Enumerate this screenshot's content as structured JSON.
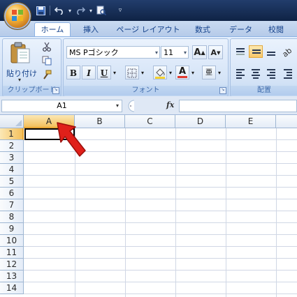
{
  "quick_access": {
    "icons": [
      "save-icon",
      "undo-icon",
      "redo-icon",
      "print-preview-icon",
      "customize-icon"
    ]
  },
  "tabs": [
    {
      "label": "ホーム",
      "active": true
    },
    {
      "label": "挿入",
      "active": false
    },
    {
      "label": "ページ レイアウト",
      "active": false
    },
    {
      "label": "数式",
      "active": false
    },
    {
      "label": "データ",
      "active": false
    },
    {
      "label": "校閲",
      "active": false
    }
  ],
  "clipboard_group": {
    "paste_label": "貼り付け",
    "group_label": "クリップボード",
    "icons": [
      "paste-icon",
      "cut-icon",
      "copy-icon",
      "format-painter-icon"
    ]
  },
  "font_group": {
    "font_name": "MS Pゴシック",
    "font_size": "11",
    "group_label": "フォント",
    "bold": "B",
    "italic": "I",
    "underline": "U",
    "grow_font": "A",
    "shrink_font": "A",
    "font_color_letter": "A",
    "phonetic": "亜",
    "font_color": "#e03a2f",
    "fill_color": "#f5d22e"
  },
  "alignment_group": {
    "group_label": "配置"
  },
  "formula_bar": {
    "name_box": "A1",
    "fx_label": "fx",
    "content": ""
  },
  "sheet": {
    "columns": [
      "A",
      "B",
      "C",
      "D",
      "E"
    ],
    "rows": [
      "1",
      "2",
      "3",
      "4",
      "5",
      "6",
      "7",
      "8",
      "9",
      "10",
      "11",
      "12",
      "13",
      "14"
    ],
    "selected_column": "A",
    "selected_row": "1",
    "active_cell": "A1"
  },
  "colors": {
    "ribbon_blue": "#d6e4f7",
    "header_selected": "#f4c05c",
    "arrow_red": "#e0201a"
  }
}
